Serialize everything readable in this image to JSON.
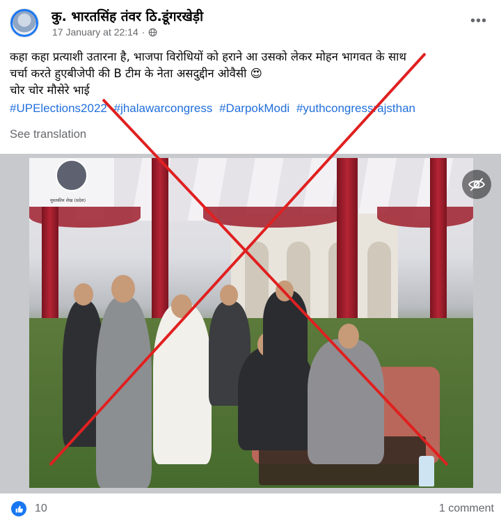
{
  "post": {
    "author": "कु. भारतसिंह तंवर ठि.डूंगरखेड़ी",
    "timestamp": "17 January at 22:14",
    "separator": "·",
    "audience_icon": "globe-icon",
    "more_icon": "ellipsis-icon",
    "text_lines": [
      "कहा कहा प्रत्याशी उतारना है, भाजपा विरोधियों को हराने आ  उसको लेकर मोहन भागवत के साथ",
      "चर्चा करते हुएबीजेपी की B टीम के नेता असदुद्दीन ओवैसी 😍",
      "चोर चोर मौसेरे भाई"
    ],
    "hashtags": [
      "#UPElections2022",
      "#jhalawarcongress",
      "#DarpokModi",
      "#yuthcongressrajsthan"
    ],
    "see_translation": "See translation"
  },
  "media": {
    "inset_name": "मुस्तकीम शेख (प्रदेश)",
    "cross_color": "#e02020",
    "eye_icon": "eye-slash-icon"
  },
  "footer": {
    "like_icon": "like-icon",
    "reactions_count": "10",
    "comments_count": "1 comment",
    "brand_color": "#1877f2"
  }
}
